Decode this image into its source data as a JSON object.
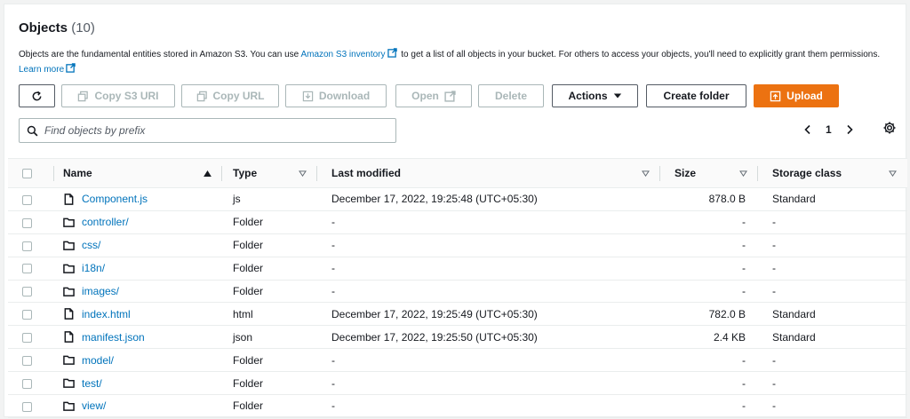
{
  "header": {
    "title": "Objects",
    "count": "(10)"
  },
  "description": {
    "part1": "Objects are the fundamental entities stored in Amazon S3. You can use ",
    "inventory_link": "Amazon S3 inventory",
    "part2": " to get a list of all objects in your bucket. For others to access your objects, you'll need to explicitly grant them permissions. ",
    "learn_more": "Learn more"
  },
  "toolbar": {
    "copy_s3_uri": "Copy S3 URI",
    "copy_url": "Copy URL",
    "download": "Download",
    "open": "Open",
    "delete": "Delete",
    "actions": "Actions",
    "create_folder": "Create folder",
    "upload": "Upload"
  },
  "search": {
    "placeholder": "Find objects by prefix"
  },
  "pagination": {
    "page": "1"
  },
  "columns": {
    "name": "Name",
    "type": "Type",
    "last_modified": "Last modified",
    "size": "Size",
    "storage_class": "Storage class"
  },
  "rows": [
    {
      "name": "Component.js",
      "kind": "file",
      "type": "js",
      "modified": "December 17, 2022, 19:25:48 (UTC+05:30)",
      "size": "878.0 B",
      "storage": "Standard"
    },
    {
      "name": "controller/",
      "kind": "folder",
      "type": "Folder",
      "modified": "-",
      "size": "-",
      "storage": "-"
    },
    {
      "name": "css/",
      "kind": "folder",
      "type": "Folder",
      "modified": "-",
      "size": "-",
      "storage": "-"
    },
    {
      "name": "i18n/",
      "kind": "folder",
      "type": "Folder",
      "modified": "-",
      "size": "-",
      "storage": "-"
    },
    {
      "name": "images/",
      "kind": "folder",
      "type": "Folder",
      "modified": "-",
      "size": "-",
      "storage": "-"
    },
    {
      "name": "index.html",
      "kind": "file",
      "type": "html",
      "modified": "December 17, 2022, 19:25:49 (UTC+05:30)",
      "size": "782.0 B",
      "storage": "Standard"
    },
    {
      "name": "manifest.json",
      "kind": "file",
      "type": "json",
      "modified": "December 17, 2022, 19:25:50 (UTC+05:30)",
      "size": "2.4 KB",
      "storage": "Standard"
    },
    {
      "name": "model/",
      "kind": "folder",
      "type": "Folder",
      "modified": "-",
      "size": "-",
      "storage": "-"
    },
    {
      "name": "test/",
      "kind": "folder",
      "type": "Folder",
      "modified": "-",
      "size": "-",
      "storage": "-"
    },
    {
      "name": "view/",
      "kind": "folder",
      "type": "Folder",
      "modified": "-",
      "size": "-",
      "storage": "-"
    }
  ],
  "colors": {
    "link": "#0073bb",
    "primary": "#ec7211",
    "border": "#aab7b8"
  }
}
